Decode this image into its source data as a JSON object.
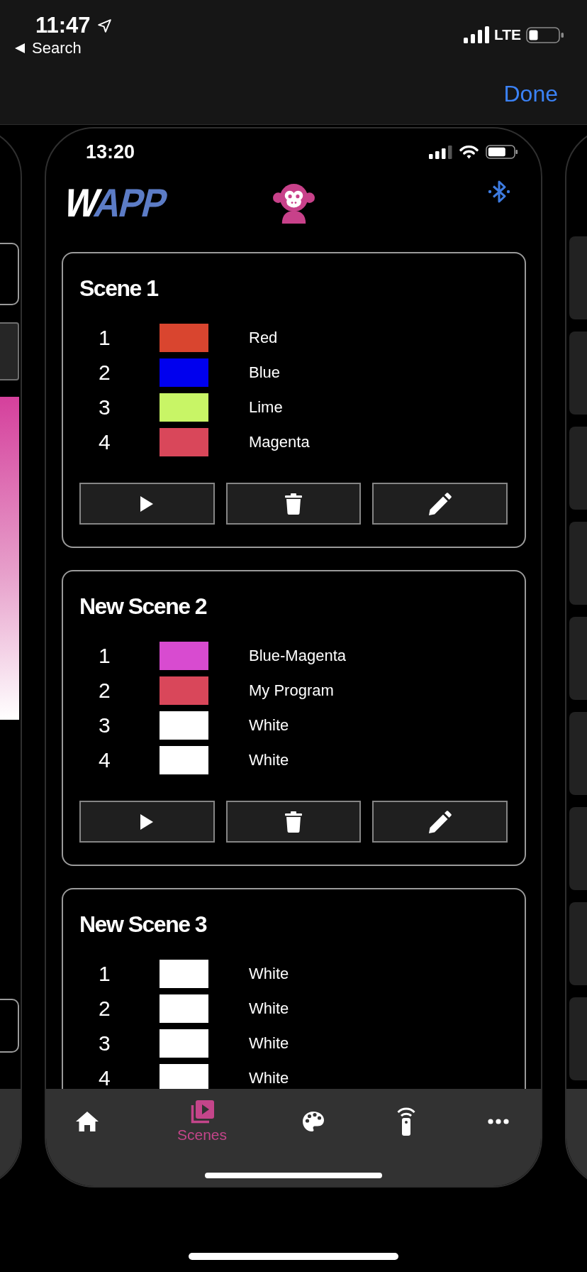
{
  "status_bar": {
    "time": "11:47",
    "back_label": "Search",
    "network": "LTE"
  },
  "nav_bar": {
    "done": "Done"
  },
  "device": {
    "time": "13:20",
    "logo": "WAPP"
  },
  "scenes": [
    {
      "title": "Scene 1",
      "slots": [
        {
          "number": "1",
          "color": "#d9452f",
          "label": "Red"
        },
        {
          "number": "2",
          "color": "#0000ee",
          "label": "Blue"
        },
        {
          "number": "3",
          "color": "#c8f566",
          "label": "Lime"
        },
        {
          "number": "4",
          "color": "#d9475a",
          "label": "Magenta"
        }
      ],
      "actions": [
        {
          "kind": "play"
        },
        {
          "kind": "delete"
        },
        {
          "kind": "edit"
        }
      ]
    },
    {
      "title": "New Scene 2",
      "slots": [
        {
          "number": "1",
          "color": "#d84bd0",
          "label": "Blue-Magenta"
        },
        {
          "number": "2",
          "color": "#d9475a",
          "label": "My Program"
        },
        {
          "number": "3",
          "color": "#ffffff",
          "label": "White"
        },
        {
          "number": "4",
          "color": "#ffffff",
          "label": "White"
        }
      ],
      "actions": [
        {
          "kind": "play"
        },
        {
          "kind": "delete"
        },
        {
          "kind": "edit"
        }
      ]
    },
    {
      "title": "New Scene 3",
      "slots": [
        {
          "number": "1",
          "color": "#ffffff",
          "label": "White"
        },
        {
          "number": "2",
          "color": "#ffffff",
          "label": "White"
        },
        {
          "number": "3",
          "color": "#ffffff",
          "label": "White"
        },
        {
          "number": "4",
          "color": "#ffffff",
          "label": "White"
        }
      ]
    }
  ],
  "tab_bar": [
    {
      "kind": "home",
      "selected": false
    },
    {
      "kind": "scenes",
      "label": "Scenes",
      "selected": true
    },
    {
      "kind": "palette",
      "selected": false
    },
    {
      "kind": "remote",
      "selected": false
    },
    {
      "kind": "more",
      "selected": false
    }
  ]
}
